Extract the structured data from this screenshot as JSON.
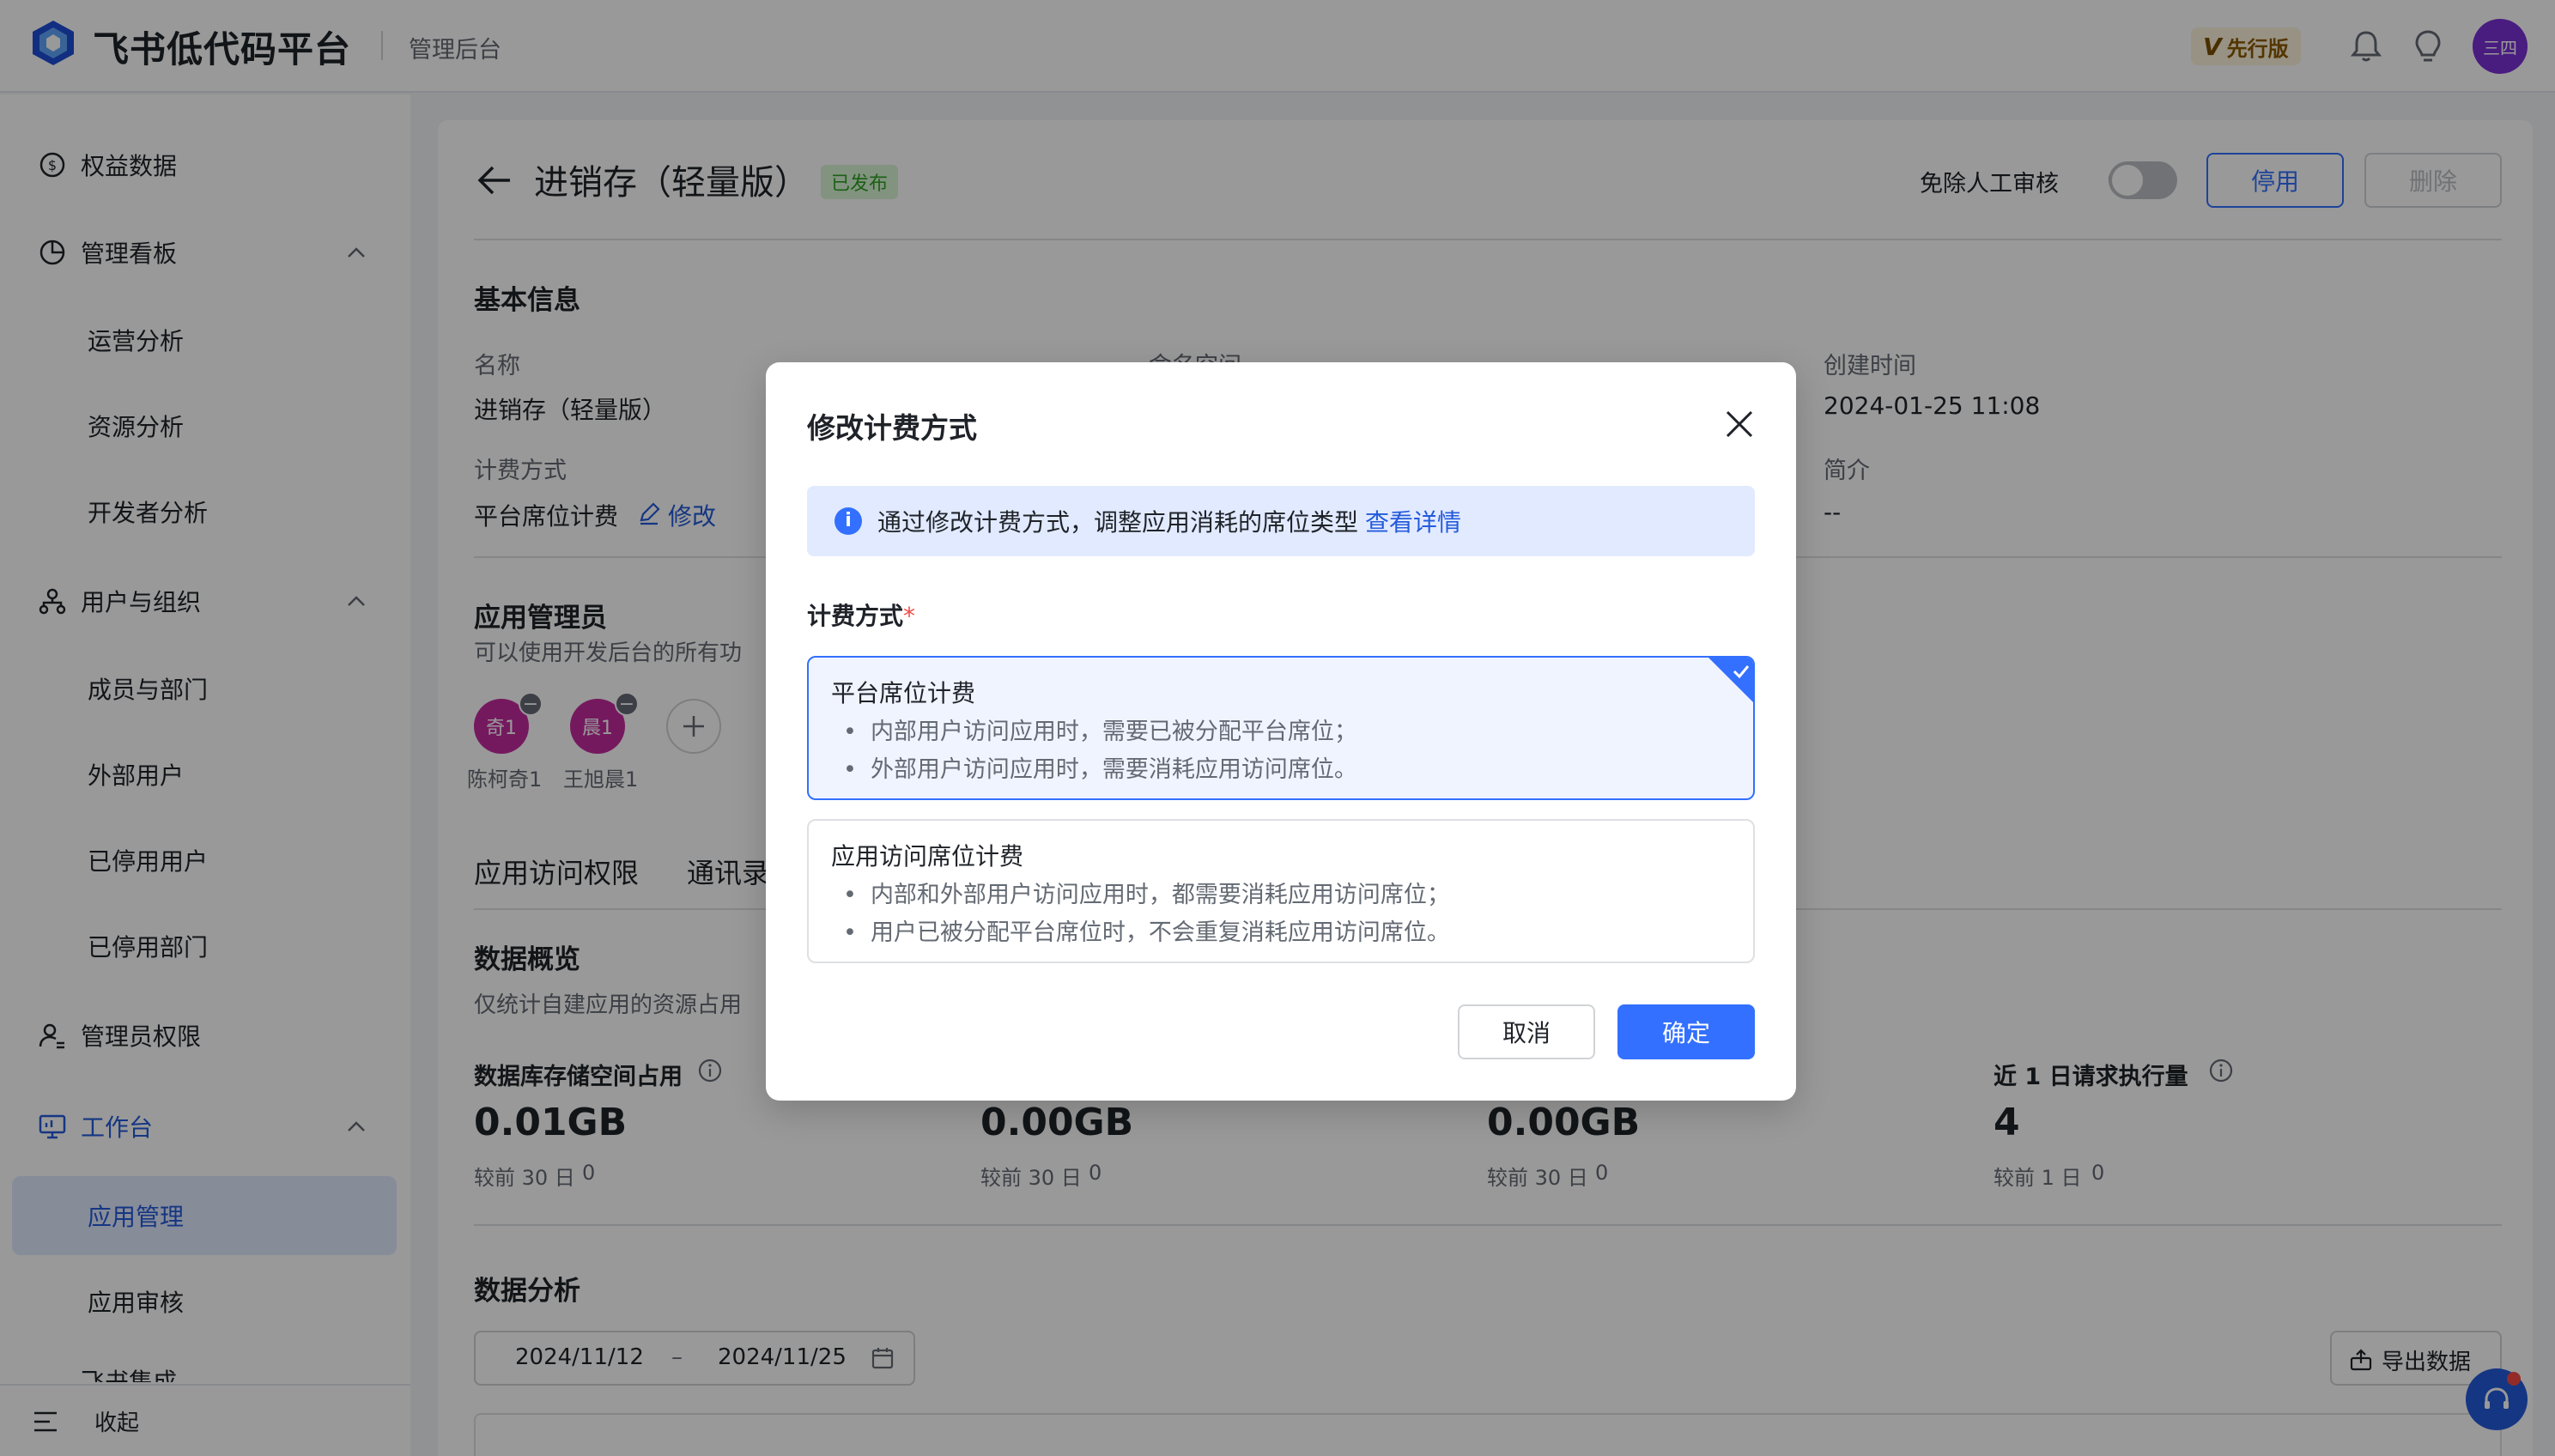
{
  "topbar": {
    "brand": "飞书低代码平台",
    "subtitle": "管理后台",
    "edition_v": "V",
    "edition": "先行版",
    "avatar": "三四"
  },
  "sidebar": {
    "items": [
      {
        "label": "权益数据"
      },
      {
        "label": "管理看板"
      },
      {
        "label": "运营分析"
      },
      {
        "label": "资源分析"
      },
      {
        "label": "开发者分析"
      },
      {
        "label": "用户与组织"
      },
      {
        "label": "成员与部门"
      },
      {
        "label": "外部用户"
      },
      {
        "label": "已停用用户"
      },
      {
        "label": "已停用部门"
      },
      {
        "label": "管理员权限"
      },
      {
        "label": "工作台"
      },
      {
        "label": "应用管理"
      },
      {
        "label": "应用审核"
      },
      {
        "label": "飞书集成"
      }
    ],
    "collapse": "收起"
  },
  "main": {
    "title": "进销存（轻量版）",
    "status": "已发布",
    "auto_review": "免除人工审核",
    "disable_btn": "停用",
    "delete_btn": "删除",
    "basic_info": "基本信息",
    "name_label": "名称",
    "name_value": "进销存（轻量版）",
    "namespace_label": "命名空间",
    "created_label": "创建时间",
    "created_value": "2024-01-25 11:08",
    "billing_label": "计费方式",
    "billing_value": "平台席位计费",
    "edit_link": "修改",
    "intro_label": "简介",
    "intro_value": "--",
    "admins_title": "应用管理员",
    "admins_desc": "可以使用开发后台的所有功",
    "admins": [
      {
        "avatar": "奇1",
        "name": "陈柯奇1"
      },
      {
        "avatar": "晨1",
        "name": "王旭晨1"
      }
    ],
    "tabs": [
      "应用访问权限",
      "通讯录"
    ],
    "overview_title": "数据概览",
    "overview_desc": "仅统计自建应用的资源占用",
    "stats": [
      {
        "label": "数据库存储空间占用",
        "value": "0.01GB",
        "compare": "较前 30 日",
        "delta": "0"
      },
      {
        "label": "",
        "value": "0.00GB",
        "compare": "较前 30 日",
        "delta": "0"
      },
      {
        "label": "",
        "value": "0.00GB",
        "compare": "较前 30 日",
        "delta": "0"
      },
      {
        "label": "近 1 日请求执行量",
        "value": "4",
        "compare": "较前 1 日",
        "delta": "0"
      }
    ],
    "analysis_title": "数据分析",
    "date_start": "2024/11/12",
    "date_sep": "–",
    "date_end": "2024/11/25",
    "export_btn": "导出数据"
  },
  "modal": {
    "title": "修改计费方式",
    "notice": "通过修改计费方式，调整应用消耗的席位类型",
    "notice_link": "查看详情",
    "field_label": "计费方式",
    "required_mark": "*",
    "options": [
      {
        "title": "平台席位计费",
        "selected": true,
        "bullets": [
          "内部用户访问应用时，需要已被分配平台席位；",
          "外部用户访问应用时，需要消耗应用访问席位。"
        ]
      },
      {
        "title": "应用访问席位计费",
        "selected": false,
        "bullets": [
          "内部和外部用户访问应用时，都需要消耗应用访问席位；",
          "用户已被分配平台席位时，不会重复消耗应用访问席位。"
        ]
      }
    ],
    "cancel": "取消",
    "confirm": "确定"
  },
  "colors": {
    "primary": "#3370ff",
    "link": "#245bdb",
    "overlay": "rgba(0,0,0,0.40)"
  }
}
